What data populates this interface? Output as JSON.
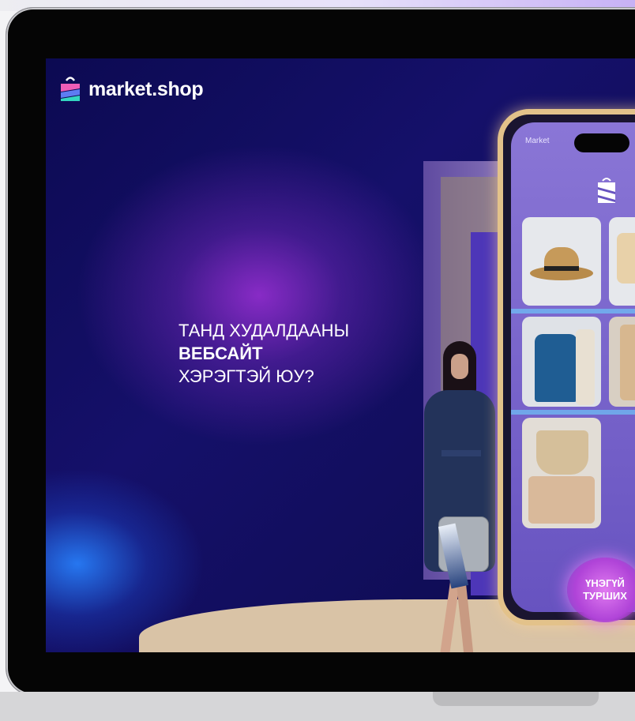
{
  "brand": {
    "name": "market.shop"
  },
  "hero": {
    "line1": "ТАНД ХУДАЛДААНЫ",
    "line2": "ВЕБСАЙТ",
    "line3": "ХЭРЭГТЭЙ ЮУ?"
  },
  "phone": {
    "header_label": "Market",
    "cta_label_1": "ҮНЭГҮЙ",
    "cta_label_2": "ТУРШИХ"
  },
  "colors": {
    "background_dark": "#0c0a52",
    "glow_purple": "#9c30d6",
    "glow_blue": "#2882ff",
    "phone_frame": "#e3c28a",
    "cta_pink": "#e07af0"
  },
  "icons": [
    "shopping-bag-logo-icon"
  ]
}
